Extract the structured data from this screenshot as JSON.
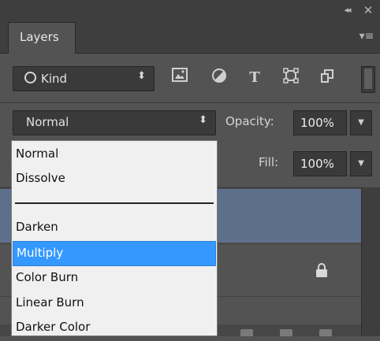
{
  "panel": {
    "collapse_glyph": "◂◂",
    "close_glyph": "✕",
    "tab_label": "Layers",
    "menu_glyph": "▾≡"
  },
  "filter": {
    "kind_label": "Kind",
    "caret": "⬍",
    "icons": [
      "image-icon",
      "adjustment-icon",
      "type-icon",
      "shape-icon",
      "smart-object-icon"
    ],
    "type_glyph": "T"
  },
  "blend": {
    "current": "Normal",
    "caret": "⬍",
    "opacity_label": "Opacity:",
    "opacity_value": "100%",
    "fill_label": "Fill:",
    "fill_value": "100%",
    "arrow_glyph": "▼",
    "options": [
      "Normal",
      "Dissolve",
      "Darken",
      "Multiply",
      "Color Burn",
      "Linear Burn",
      "Darker Color"
    ],
    "highlighted": "Multiply"
  },
  "colors": {
    "panel_bg": "#535353",
    "selected_layer": "#5d6f8a",
    "highlight": "#3399ff"
  }
}
